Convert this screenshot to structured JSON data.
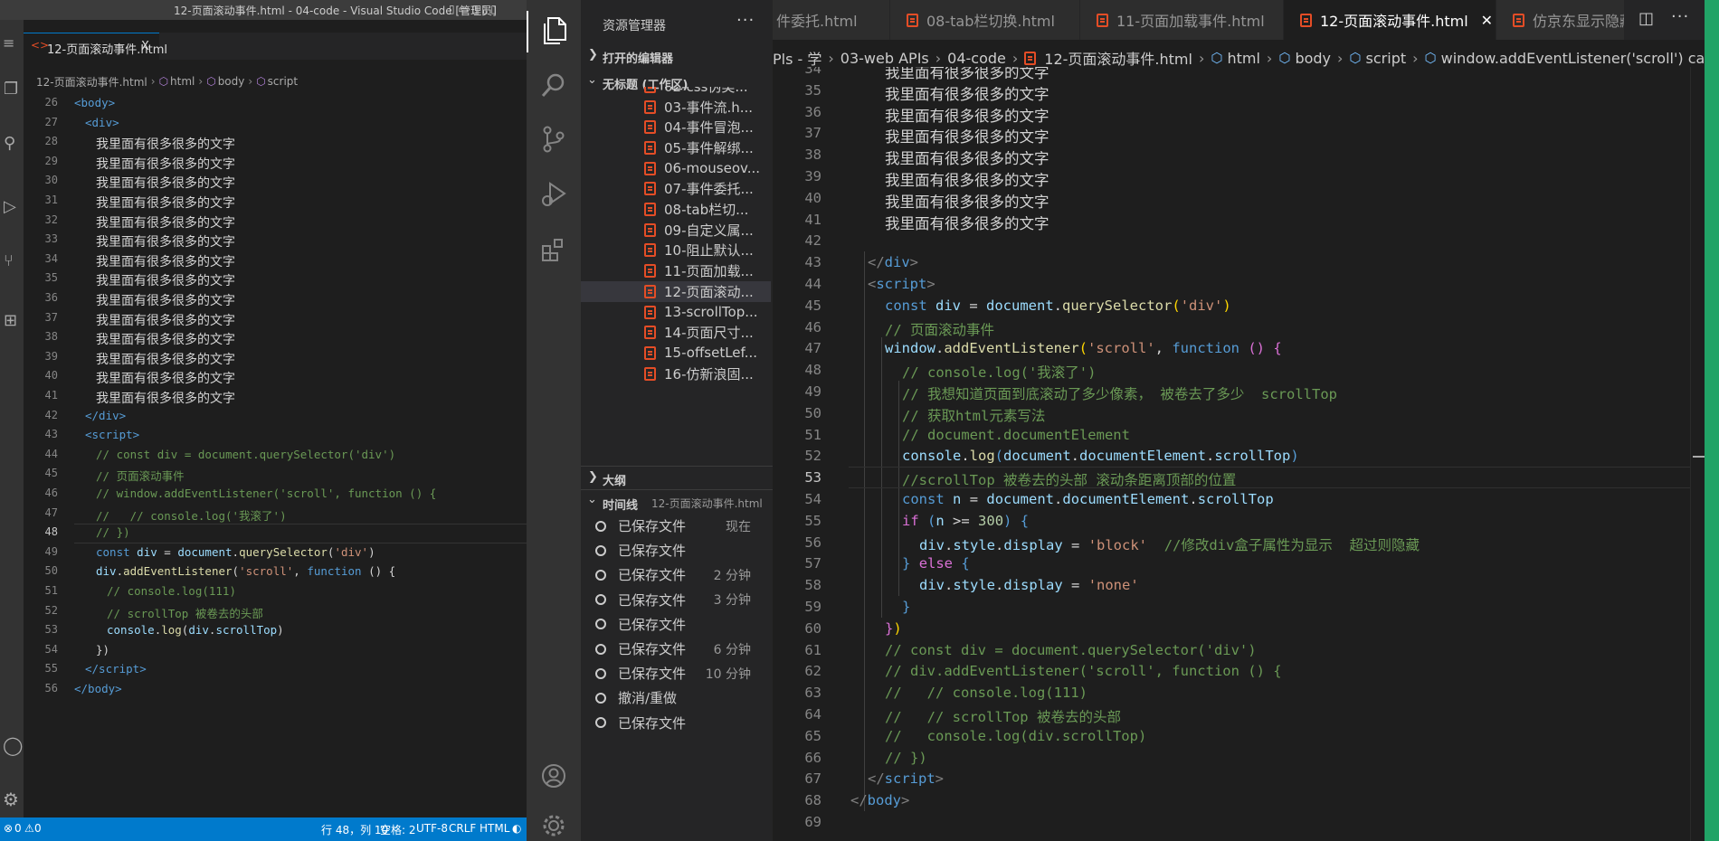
{
  "left_window": {
    "title": "12-页面滚动事件.html - 04-code - Visual Studio Code [管理员]",
    "tab_label": "12-页面滚动事件.html",
    "tab_close": "X",
    "breadcrumb": [
      "12-页面滚动事件.html",
      "html",
      "body",
      "script"
    ],
    "status": {
      "errors": "0",
      "warnings": "0",
      "position": "行 48，列 10",
      "spaces": "空格: 2",
      "encoding": "UTF-8",
      "eol": "CRLF",
      "language": "HTML"
    },
    "lines": [
      {
        "n": "26",
        "html": "<span class='tk-tag'>&lt;body&gt;</span>",
        "indent": 0
      },
      {
        "n": "27",
        "html": "<span class='tk-tag'>&lt;div&gt;</span>",
        "indent": 1
      },
      {
        "n": "28",
        "text": "我里面有很多很多的文字",
        "indent": 2
      },
      {
        "n": "29",
        "text": "我里面有很多很多的文字",
        "indent": 2
      },
      {
        "n": "30",
        "text": "我里面有很多很多的文字",
        "indent": 2
      },
      {
        "n": "31",
        "text": "我里面有很多很多的文字",
        "indent": 2
      },
      {
        "n": "32",
        "text": "我里面有很多很多的文字",
        "indent": 2
      },
      {
        "n": "33",
        "text": "我里面有很多很多的文字",
        "indent": 2
      },
      {
        "n": "34",
        "text": "我里面有很多很多的文字",
        "indent": 2
      },
      {
        "n": "35",
        "text": "我里面有很多很多的文字",
        "indent": 2
      },
      {
        "n": "36",
        "text": "我里面有很多很多的文字",
        "indent": 2
      },
      {
        "n": "37",
        "text": "我里面有很多很多的文字",
        "indent": 2
      },
      {
        "n": "38",
        "text": "我里面有很多很多的文字",
        "indent": 2
      },
      {
        "n": "39",
        "text": "我里面有很多很多的文字",
        "indent": 2
      },
      {
        "n": "40",
        "text": "我里面有很多很多的文字",
        "indent": 2
      },
      {
        "n": "41",
        "text": "我里面有很多很多的文字",
        "indent": 2
      },
      {
        "n": "42",
        "html": "<span class='tk-tag'>&lt;/div&gt;</span>",
        "indent": 1
      },
      {
        "n": "43",
        "html": "<span class='tk-tag'>&lt;script&gt;</span>",
        "indent": 1
      },
      {
        "n": "44",
        "html": "<span class='tk-cm'>// const div = document.querySelector('div')</span>",
        "indent": 2
      },
      {
        "n": "45",
        "html": "<span class='tk-cm'>// 页面滚动事件</span>",
        "indent": 2
      },
      {
        "n": "46",
        "html": "<span class='tk-cm'>// window.addEventListener('scroll', function () {</span>",
        "indent": 2
      },
      {
        "n": "47",
        "html": "<span class='tk-cm'>//   // console.log('我滚了')</span>",
        "indent": 2
      },
      {
        "n": "48",
        "html": "<span class='tk-cm'>// })</span>",
        "indent": 2
      },
      {
        "n": "49",
        "html": "<span class='tk-kw'>const</span> <span class='tk-var'>div</span> = <span class='tk-var'>document</span>.<span class='tk-fn'>querySelector</span>(<span class='tk-str'>'div'</span>)",
        "indent": 2
      },
      {
        "n": "50",
        "html": "<span class='tk-var'>div</span>.<span class='tk-fn'>addEventListener</span>(<span class='tk-str'>'scroll'</span>, <span class='tk-kw'>function</span> () {",
        "indent": 2
      },
      {
        "n": "51",
        "html": "<span class='tk-cm'>// console.log(111)</span>",
        "indent": 3
      },
      {
        "n": "52",
        "html": "<span class='tk-cm'>// scrollTop 被卷去的头部</span>",
        "indent": 3
      },
      {
        "n": "53",
        "html": "<span class='tk-var'>console</span>.<span class='tk-fn'>log</span>(<span class='tk-var'>div</span>.<span class='tk-var'>scrollTop</span>)",
        "indent": 3
      },
      {
        "n": "54",
        "html": "})",
        "indent": 2
      },
      {
        "n": "55",
        "html": "<span class='tk-tag'>&lt;/script&gt;</span>",
        "indent": 1
      },
      {
        "n": "56",
        "html": "<span class='tk-tag'>&lt;/body&gt;</span>",
        "indent": 0
      }
    ]
  },
  "explorer": {
    "header": "资源管理器",
    "open_editors": "打开的编辑器",
    "workspace": "无标题 (工作区)",
    "files": [
      "02-css伪类...",
      "03-事件流.h...",
      "04-事件冒泡...",
      "05-事件解绑...",
      "06-mouseov...",
      "07-事件委托...",
      "08-tab栏切...",
      "09-自定义属...",
      "10-阻止默认...",
      "11-页面加载...",
      "12-页面滚动...",
      "13-scrollTop...",
      "14-页面尺寸...",
      "15-offsetLef...",
      "16-仿新浪固..."
    ],
    "outline": "大纲",
    "timeline": "时间线",
    "timeline_file": "12-页面滚动事件.html",
    "timeline_items": [
      {
        "label": "已保存文件",
        "time": "现在"
      },
      {
        "label": "已保存文件",
        "time": ""
      },
      {
        "label": "已保存文件",
        "time": "2 分钟"
      },
      {
        "label": "已保存文件",
        "time": "3 分钟"
      },
      {
        "label": "已保存文件",
        "time": ""
      },
      {
        "label": "已保存文件",
        "time": "6 分钟"
      },
      {
        "label": "已保存文件",
        "time": "10 分钟"
      },
      {
        "label": "撤消/重做",
        "time": ""
      },
      {
        "label": "已保存文件",
        "time": ""
      }
    ]
  },
  "tabs": [
    {
      "label": "件委托.html",
      "active": false
    },
    {
      "label": "08-tab栏切换.html",
      "active": false
    },
    {
      "label": "11-页面加载事件.html",
      "active": false
    },
    {
      "label": "12-页面滚动事件.html",
      "active": true
    },
    {
      "label": "仿京东显示隐藏",
      "active": false
    }
  ],
  "editor_breadcrumb": [
    "Pls - 学",
    "03-web APIs",
    "04-code",
    "12-页面滚动事件.html",
    "html",
    "body",
    "script",
    "window.addEventListener('scroll') callback"
  ],
  "main_lines": [
    {
      "n": "34",
      "text": "我里面有很多很多的文字",
      "indent": 2
    },
    {
      "n": "35",
      "text": "我里面有很多很多的文字",
      "indent": 2
    },
    {
      "n": "36",
      "text": "我里面有很多很多的文字",
      "indent": 2
    },
    {
      "n": "37",
      "text": "我里面有很多很多的文字",
      "indent": 2
    },
    {
      "n": "38",
      "text": "我里面有很多很多的文字",
      "indent": 2
    },
    {
      "n": "39",
      "text": "我里面有很多很多的文字",
      "indent": 2
    },
    {
      "n": "40",
      "text": "我里面有很多很多的文字",
      "indent": 2
    },
    {
      "n": "41",
      "text": "我里面有很多很多的文字",
      "indent": 2
    },
    {
      "n": "42",
      "text": "",
      "indent": 0
    },
    {
      "n": "43",
      "html": "<span class='tk-punc'>&lt;/</span><span class='tk-tag'>div</span><span class='tk-punc'>&gt;</span>",
      "indent": 1
    },
    {
      "n": "44",
      "html": "<span class='tk-punc'>&lt;</span><span class='tk-tag'>script</span><span class='tk-punc'>&gt;</span>",
      "indent": 1
    },
    {
      "n": "45",
      "html": "<span class='tk-kw'>const</span> <span class='tk-var'>div</span> = <span class='tk-var'>document</span>.<span class='tk-fn'>querySelector</span><span class='tk-br'>(</span><span class='tk-str'>'div'</span><span class='tk-br'>)</span>",
      "indent": 2
    },
    {
      "n": "46",
      "html": "<span class='tk-cm'>// 页面滚动事件</span>",
      "indent": 2
    },
    {
      "n": "47",
      "html": "<span class='tk-var'>window</span>.<span class='tk-fn'>addEventListener</span><span class='tk-br'>(</span><span class='tk-str'>'scroll'</span>, <span class='tk-kw'>function</span> <span class='tk-pu'>()</span> <span class='tk-pu'>{</span>",
      "indent": 2
    },
    {
      "n": "48",
      "html": "<span class='tk-cm'>// console.log('我滚了')</span>",
      "indent": 3
    },
    {
      "n": "49",
      "html": "<span class='tk-cm'>// 我想知道页面到底滚动了多少像素， 被卷去了多少  scrollTop</span>",
      "indent": 3
    },
    {
      "n": "50",
      "html": "<span class='tk-cm'>// 获取html元素写法</span>",
      "indent": 3
    },
    {
      "n": "51",
      "html": "<span class='tk-cm'>// document.documentElement</span>",
      "indent": 3
    },
    {
      "n": "52",
      "html": "<span class='tk-var'>console</span>.<span class='tk-fn'>log</span><span class='tk-kw'>(</span><span class='tk-var'>document</span>.<span class='tk-var'>documentElement</span>.<span class='tk-var'>scrollTop</span><span class='tk-kw'>)</span>",
      "indent": 3
    },
    {
      "n": "53",
      "html": "<span class='tk-cm'>//scrollTop 被卷去的头部 滚动条距离顶部的位置</span>",
      "indent": 3,
      "current": true
    },
    {
      "n": "54",
      "html": "<span class='tk-kw'>const</span> <span class='tk-var'>n</span> = <span class='tk-var'>document</span>.<span class='tk-var'>documentElement</span>.<span class='tk-var'>scrollTop</span>",
      "indent": 3
    },
    {
      "n": "55",
      "html": "<span class='tk-pu'>if</span> <span class='tk-kw'>(</span><span class='tk-var'>n</span> &gt;= <span class='tk-num'>300</span><span class='tk-kw'>)</span> <span class='tk-kw'>{</span>",
      "indent": 3
    },
    {
      "n": "56",
      "html": "<span class='tk-var'>div</span>.<span class='tk-var'>style</span>.<span class='tk-var'>display</span> = <span class='tk-str'>'block'</span>  <span class='tk-cm'>//修改div盒子属性为显示  超过则隐藏</span>",
      "indent": 4
    },
    {
      "n": "57",
      "html": "<span class='tk-kw'>}</span> <span class='tk-pu'>else</span> <span class='tk-kw'>{</span>",
      "indent": 3
    },
    {
      "n": "58",
      "html": "<span class='tk-var'>div</span>.<span class='tk-var'>style</span>.<span class='tk-var'>display</span> = <span class='tk-str'>'none'</span>",
      "indent": 4
    },
    {
      "n": "59",
      "html": "<span class='tk-kw'>}</span>",
      "indent": 3
    },
    {
      "n": "60",
      "html": "<span class='tk-pu'>}</span><span class='tk-br'>)</span>",
      "indent": 2
    },
    {
      "n": "61",
      "html": "<span class='tk-cm'>// const div = document.querySelector('div')</span>",
      "indent": 2
    },
    {
      "n": "62",
      "html": "<span class='tk-cm'>// div.addEventListener('scroll', function () {</span>",
      "indent": 2
    },
    {
      "n": "63",
      "html": "<span class='tk-cm'>//   // console.log(111)</span>",
      "indent": 2
    },
    {
      "n": "64",
      "html": "<span class='tk-cm'>//   // scrollTop 被卷去的头部</span>",
      "indent": 2
    },
    {
      "n": "65",
      "html": "<span class='tk-cm'>//   console.log(div.scrollTop)</span>",
      "indent": 2
    },
    {
      "n": "66",
      "html": "<span class='tk-cm'>// })</span>",
      "indent": 2
    },
    {
      "n": "67",
      "html": "<span class='tk-punc'>&lt;/</span><span class='tk-tag'>script</span><span class='tk-punc'>&gt;</span>",
      "indent": 1
    },
    {
      "n": "68",
      "html": "<span class='tk-punc'>&lt;/</span><span class='tk-tag'>body</span><span class='tk-punc'>&gt;</span>",
      "indent": 0
    },
    {
      "n": "69",
      "text": "",
      "indent": 0
    }
  ],
  "colors": {
    "status_bar": "#007acc",
    "activity_bar": "#333333",
    "sidebar": "#252526",
    "editor": "#1e1e1e",
    "accent_green": "#21a366"
  }
}
